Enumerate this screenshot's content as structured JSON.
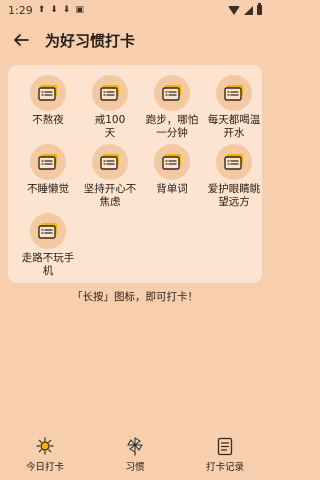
{
  "status": {
    "time": "1:29"
  },
  "header": {
    "title": "为好习惯打卡"
  },
  "habits": [
    {
      "label": "不熬夜"
    },
    {
      "label": "戒100天"
    },
    {
      "label": "跑步，哪怕一分钟"
    },
    {
      "label": "每天都喝温开水"
    },
    {
      "label": "不睡懒觉"
    },
    {
      "label": "坚持开心不焦虑"
    },
    {
      "label": "背单词"
    },
    {
      "label": "爱护眼睛眺望远方"
    },
    {
      "label": "走路不玩手机"
    }
  ],
  "hint": "「长按」图标，即可打卡！",
  "nav": [
    {
      "label": "今日打卡",
      "icon": "sun-icon"
    },
    {
      "label": "习惯",
      "icon": "pinwheel-icon"
    },
    {
      "label": "打卡记录",
      "icon": "record-icon"
    }
  ],
  "colors": {
    "background": "#f7cfae",
    "card": "#fde4d1",
    "icon_circle": "#f3c9a4",
    "icon_accent": "#f0b400"
  }
}
